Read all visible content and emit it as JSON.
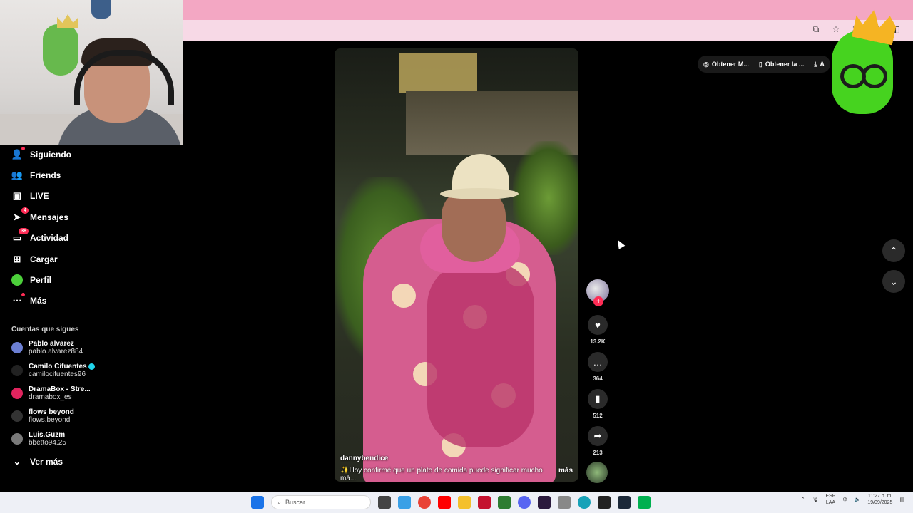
{
  "sidebar": {
    "nav": [
      {
        "label": "Siguiendo",
        "icon": "person-icon",
        "dot": true
      },
      {
        "label": "Friends",
        "icon": "friends-icon"
      },
      {
        "label": "LIVE",
        "icon": "live-icon"
      },
      {
        "label": "Mensajes",
        "icon": "send-icon",
        "badge": "4"
      },
      {
        "label": "Actividad",
        "icon": "activity-icon",
        "badge": "38"
      },
      {
        "label": "Cargar",
        "icon": "upload-icon"
      },
      {
        "label": "Perfil",
        "icon": "avatar-icon"
      },
      {
        "label": "Más",
        "icon": "more-icon",
        "dot": true
      }
    ],
    "following_title": "Cuentas que sigues",
    "accounts": [
      {
        "name": "Pablo alvarez",
        "user": "pablo.alvarez884",
        "color": "#6c7fd3"
      },
      {
        "name": "Camilo Cifuentes",
        "user": "camilocifuentes96",
        "verified": true,
        "color": "#222222"
      },
      {
        "name": "DramaBox - Stre...",
        "user": "dramabox_es",
        "color": "#e0245e"
      },
      {
        "name": "flows beyond",
        "user": "flows.beyond",
        "color": "#333333"
      },
      {
        "name": "Luis.Guzm",
        "user": "bbetto94.25",
        "color": "#7a7a7a"
      }
    ],
    "see_more": "Ver más"
  },
  "video": {
    "author": "dannybendice",
    "caption": "✨Hoy confirmé que un plato de comida puede significar mucho má...",
    "more": "más"
  },
  "actions": {
    "likes": "13.2K",
    "comments": "364",
    "saves": "512",
    "shares": "213"
  },
  "chips": [
    {
      "label": "Obtener M...",
      "icon": "app-icon"
    },
    {
      "label": "Obtener la ...",
      "icon": "phone-icon"
    },
    {
      "label": "A",
      "icon": "download-icon"
    }
  ],
  "taskbar": {
    "search_placeholder": "Buscar",
    "lang_line1": "ESP",
    "lang_line2": "LAA",
    "time": "11:27 p. m.",
    "date": "19/09/2025"
  },
  "colors": {
    "accent": "#fe2c55",
    "browser_top": "#f3a7c3",
    "mascot": "#46d31f"
  }
}
